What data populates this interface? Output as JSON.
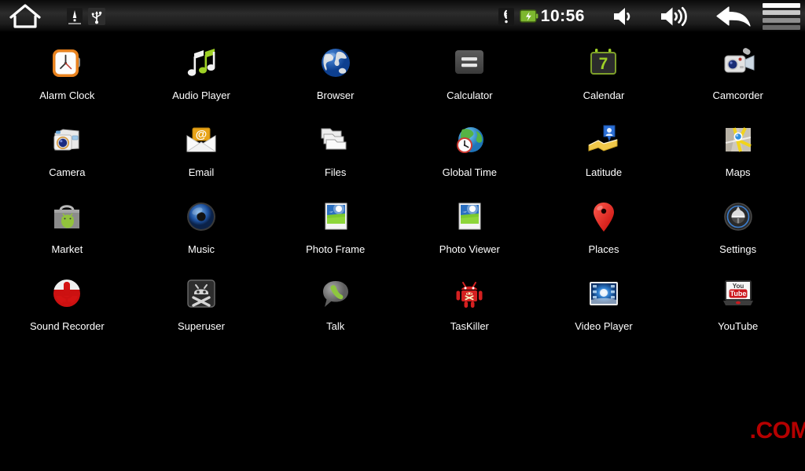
{
  "statusbar": {
    "home_icon": "home-icon",
    "left_icons": [
      {
        "name": "warning-icon",
        "label": "!"
      },
      {
        "name": "usb-icon",
        "label": "USB"
      }
    ],
    "wifi_icon": "wifi-icon",
    "battery_icon": "battery-charging-icon",
    "time": "10:56",
    "volume_down_icon": "volume-down-icon",
    "volume_up_icon": "volume-up-icon",
    "back_icon": "back-arrow-icon",
    "menu_icon": "menu-hamburger-icon",
    "colors": {
      "battery_green": "#8ec63f",
      "text": "#ffffff",
      "bar_top": "#0a0a0a",
      "bar_mid": "#2c2c2c"
    }
  },
  "apps": [
    {
      "label": "Alarm Clock",
      "icon": "alarm-clock-icon"
    },
    {
      "label": "Audio Player",
      "icon": "audio-player-icon"
    },
    {
      "label": "Browser",
      "icon": "browser-globe-icon"
    },
    {
      "label": "Calculator",
      "icon": "calculator-icon"
    },
    {
      "label": "Calendar",
      "icon": "calendar-icon"
    },
    {
      "label": "Camcorder",
      "icon": "camcorder-icon"
    },
    {
      "label": "Camera",
      "icon": "camera-icon"
    },
    {
      "label": "Email",
      "icon": "email-envelope-icon"
    },
    {
      "label": "Files",
      "icon": "files-folder-icon"
    },
    {
      "label": "Global Time",
      "icon": "global-time-icon"
    },
    {
      "label": "Latitude",
      "icon": "latitude-icon"
    },
    {
      "label": "Maps",
      "icon": "maps-icon"
    },
    {
      "label": "Market",
      "icon": "market-bag-icon"
    },
    {
      "label": "Music",
      "icon": "music-speaker-icon"
    },
    {
      "label": "Photo Frame",
      "icon": "photo-frame-icon"
    },
    {
      "label": "Photo Viewer",
      "icon": "photo-viewer-icon"
    },
    {
      "label": "Places",
      "icon": "places-pin-icon"
    },
    {
      "label": "Settings",
      "icon": "settings-dial-icon"
    },
    {
      "label": "Sound Recorder",
      "icon": "sound-recorder-mic-icon"
    },
    {
      "label": "Superuser",
      "icon": "superuser-skull-icon"
    },
    {
      "label": "Talk",
      "icon": "talk-balloon-icon"
    },
    {
      "label": "TasKiller",
      "icon": "taskiller-android-icon"
    },
    {
      "label": "Video Player",
      "icon": "video-player-icon"
    },
    {
      "label": "YouTube",
      "icon": "youtube-icon"
    }
  ],
  "calendar_day": "7",
  "youtube": {
    "you": "You",
    "tube": "Tube"
  },
  "watermark": {
    "text": ".COM",
    "color": "#b50000"
  }
}
